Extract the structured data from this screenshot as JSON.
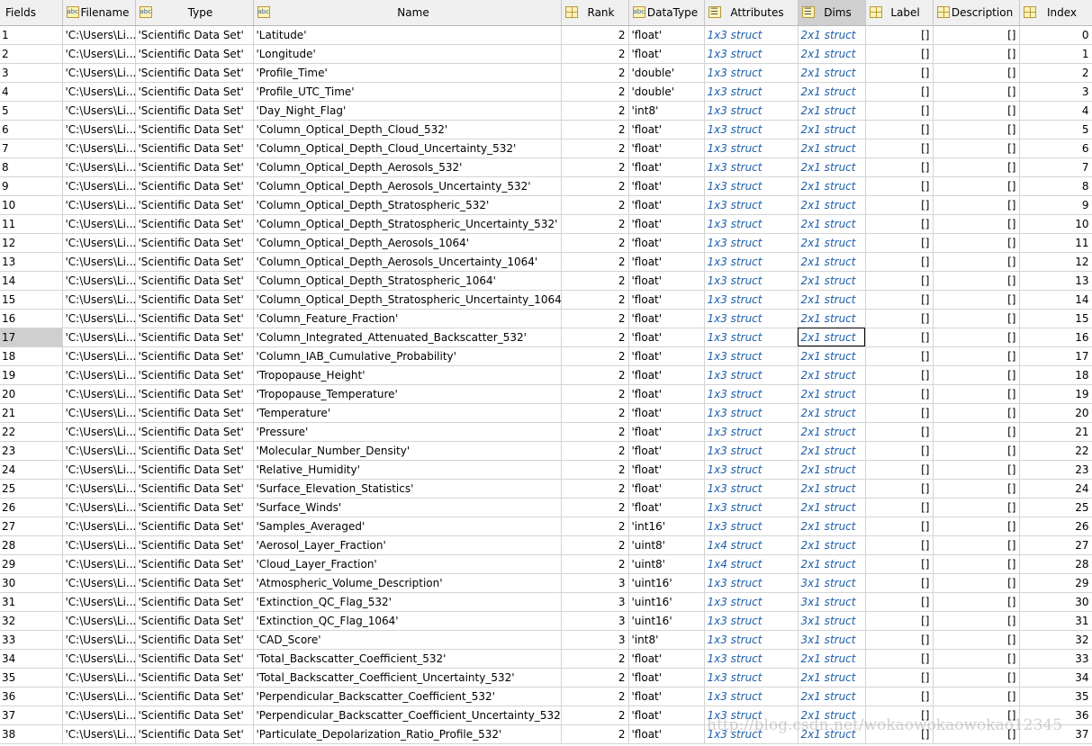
{
  "columns": [
    {
      "label": "Fields",
      "icon": ""
    },
    {
      "label": "Filename",
      "icon": "abc"
    },
    {
      "label": "Type",
      "icon": "abc"
    },
    {
      "label": "Name",
      "icon": "abc"
    },
    {
      "label": "Rank",
      "icon": "grid"
    },
    {
      "label": "DataType",
      "icon": "abc"
    },
    {
      "label": "Attributes",
      "icon": "struct"
    },
    {
      "label": "Dims",
      "icon": "struct"
    },
    {
      "label": "Label",
      "icon": "grid"
    },
    {
      "label": "Description",
      "icon": "grid"
    },
    {
      "label": "Index",
      "icon": "grid"
    }
  ],
  "selected_row": 17,
  "selected_column": "Dims",
  "filename": "'C:\\Users\\Li...",
  "type": "'Scientific Data Set'",
  "empty": "[]",
  "rows": [
    [
      "'Latitude'",
      2,
      "'float'",
      "1x3 struct",
      "2x1 struct",
      0
    ],
    [
      "'Longitude'",
      2,
      "'float'",
      "1x3 struct",
      "2x1 struct",
      1
    ],
    [
      "'Profile_Time'",
      2,
      "'double'",
      "1x3 struct",
      "2x1 struct",
      2
    ],
    [
      "'Profile_UTC_Time'",
      2,
      "'double'",
      "1x3 struct",
      "2x1 struct",
      3
    ],
    [
      "'Day_Night_Flag'",
      2,
      "'int8'",
      "1x3 struct",
      "2x1 struct",
      4
    ],
    [
      "'Column_Optical_Depth_Cloud_532'",
      2,
      "'float'",
      "1x3 struct",
      "2x1 struct",
      5
    ],
    [
      "'Column_Optical_Depth_Cloud_Uncertainty_532'",
      2,
      "'float'",
      "1x3 struct",
      "2x1 struct",
      6
    ],
    [
      "'Column_Optical_Depth_Aerosols_532'",
      2,
      "'float'",
      "1x3 struct",
      "2x1 struct",
      7
    ],
    [
      "'Column_Optical_Depth_Aerosols_Uncertainty_532'",
      2,
      "'float'",
      "1x3 struct",
      "2x1 struct",
      8
    ],
    [
      "'Column_Optical_Depth_Stratospheric_532'",
      2,
      "'float'",
      "1x3 struct",
      "2x1 struct",
      9
    ],
    [
      "'Column_Optical_Depth_Stratospheric_Uncertainty_532'",
      2,
      "'float'",
      "1x3 struct",
      "2x1 struct",
      10
    ],
    [
      "'Column_Optical_Depth_Aerosols_1064'",
      2,
      "'float'",
      "1x3 struct",
      "2x1 struct",
      11
    ],
    [
      "'Column_Optical_Depth_Aerosols_Uncertainty_1064'",
      2,
      "'float'",
      "1x3 struct",
      "2x1 struct",
      12
    ],
    [
      "'Column_Optical_Depth_Stratospheric_1064'",
      2,
      "'float'",
      "1x3 struct",
      "2x1 struct",
      13
    ],
    [
      "'Column_Optical_Depth_Stratospheric_Uncertainty_1064'",
      2,
      "'float'",
      "1x3 struct",
      "2x1 struct",
      14
    ],
    [
      "'Column_Feature_Fraction'",
      2,
      "'float'",
      "1x3 struct",
      "2x1 struct",
      15
    ],
    [
      "'Column_Integrated_Attenuated_Backscatter_532'",
      2,
      "'float'",
      "1x3 struct",
      "2x1 struct",
      16
    ],
    [
      "'Column_IAB_Cumulative_Probability'",
      2,
      "'float'",
      "1x3 struct",
      "2x1 struct",
      17
    ],
    [
      "'Tropopause_Height'",
      2,
      "'float'",
      "1x3 struct",
      "2x1 struct",
      18
    ],
    [
      "'Tropopause_Temperature'",
      2,
      "'float'",
      "1x3 struct",
      "2x1 struct",
      19
    ],
    [
      "'Temperature'",
      2,
      "'float'",
      "1x3 struct",
      "2x1 struct",
      20
    ],
    [
      "'Pressure'",
      2,
      "'float'",
      "1x3 struct",
      "2x1 struct",
      21
    ],
    [
      "'Molecular_Number_Density'",
      2,
      "'float'",
      "1x3 struct",
      "2x1 struct",
      22
    ],
    [
      "'Relative_Humidity'",
      2,
      "'float'",
      "1x3 struct",
      "2x1 struct",
      23
    ],
    [
      "'Surface_Elevation_Statistics'",
      2,
      "'float'",
      "1x3 struct",
      "2x1 struct",
      24
    ],
    [
      "'Surface_Winds'",
      2,
      "'float'",
      "1x3 struct",
      "2x1 struct",
      25
    ],
    [
      "'Samples_Averaged'",
      2,
      "'int16'",
      "1x3 struct",
      "2x1 struct",
      26
    ],
    [
      "'Aerosol_Layer_Fraction'",
      2,
      "'uint8'",
      "1x4 struct",
      "2x1 struct",
      27
    ],
    [
      "'Cloud_Layer_Fraction'",
      2,
      "'uint8'",
      "1x4 struct",
      "2x1 struct",
      28
    ],
    [
      "'Atmospheric_Volume_Description'",
      3,
      "'uint16'",
      "1x3 struct",
      "3x1 struct",
      29
    ],
    [
      "'Extinction_QC_Flag_532'",
      3,
      "'uint16'",
      "1x3 struct",
      "3x1 struct",
      30
    ],
    [
      "'Extinction_QC_Flag_1064'",
      3,
      "'uint16'",
      "1x3 struct",
      "3x1 struct",
      31
    ],
    [
      "'CAD_Score'",
      3,
      "'int8'",
      "1x3 struct",
      "3x1 struct",
      32
    ],
    [
      "'Total_Backscatter_Coefficient_532'",
      2,
      "'float'",
      "1x3 struct",
      "2x1 struct",
      33
    ],
    [
      "'Total_Backscatter_Coefficient_Uncertainty_532'",
      2,
      "'float'",
      "1x3 struct",
      "2x1 struct",
      34
    ],
    [
      "'Perpendicular_Backscatter_Coefficient_532'",
      2,
      "'float'",
      "1x3 struct",
      "2x1 struct",
      35
    ],
    [
      "'Perpendicular_Backscatter_Coefficient_Uncertainty_532'",
      2,
      "'float'",
      "1x3 struct",
      "2x1 struct",
      36
    ],
    [
      "'Particulate_Depolarization_Ratio_Profile_532'",
      2,
      "'float'",
      "1x3 struct",
      "2x1 struct",
      37
    ]
  ],
  "watermark": "http://blog.csdn.net/wokaowokaowokao12345"
}
